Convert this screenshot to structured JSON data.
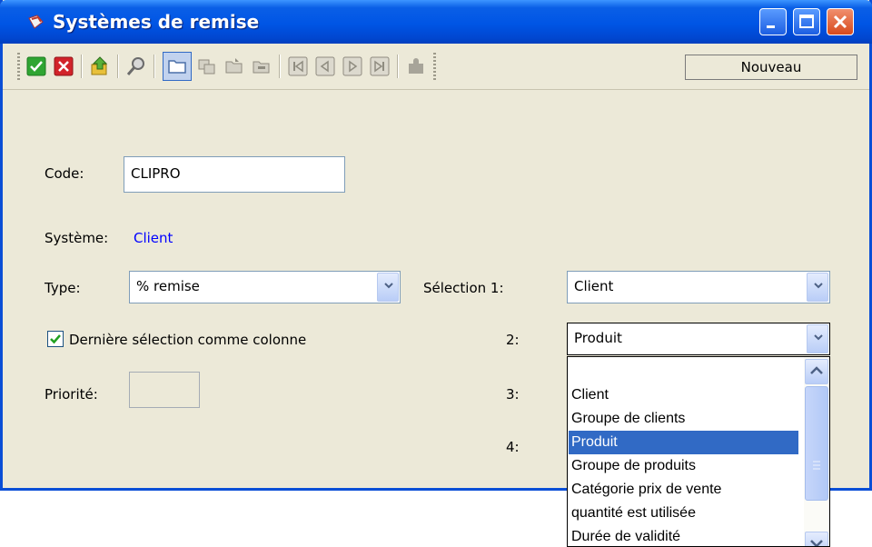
{
  "window": {
    "title": "Systèmes de remise"
  },
  "toolbar": {
    "nouveau_label": "Nouveau",
    "icons": [
      "confirm-icon",
      "cancel-icon",
      "export-icon",
      "search-icon",
      "folder-icon",
      "copy-icon",
      "folder-open-icon",
      "folder-closed-icon",
      "first-record-icon",
      "previous-record-icon",
      "next-record-icon",
      "last-record-icon",
      "puzzle-icon"
    ]
  },
  "form": {
    "code_label": "Code:",
    "code_value": "CLIPRO",
    "system_label": "Système:",
    "system_value": "Client",
    "type_label": "Type:",
    "type_value": "% remise",
    "selection1_label": "Sélection 1:",
    "selection1_value": "Client",
    "selection2_label": "2:",
    "selection2_value": "Produit",
    "selection3_label": "3:",
    "selection4_label": "4:",
    "last_selection_label": "Dernière sélection comme colonne",
    "last_selection_checked": true,
    "priority_label": "Priorité:",
    "priority_value": ""
  },
  "dropdown": {
    "items": [
      "",
      "Client",
      "Groupe de clients",
      "Produit",
      "Groupe de produits",
      "Catégorie prix de vente",
      "quantité est utilisée",
      "Durée de validité"
    ],
    "selected_index": 3
  },
  "colors": {
    "accent": "#316ac5",
    "link": "#0000ff",
    "title_bar": "#0055e5",
    "panel": "#ece9d8"
  }
}
